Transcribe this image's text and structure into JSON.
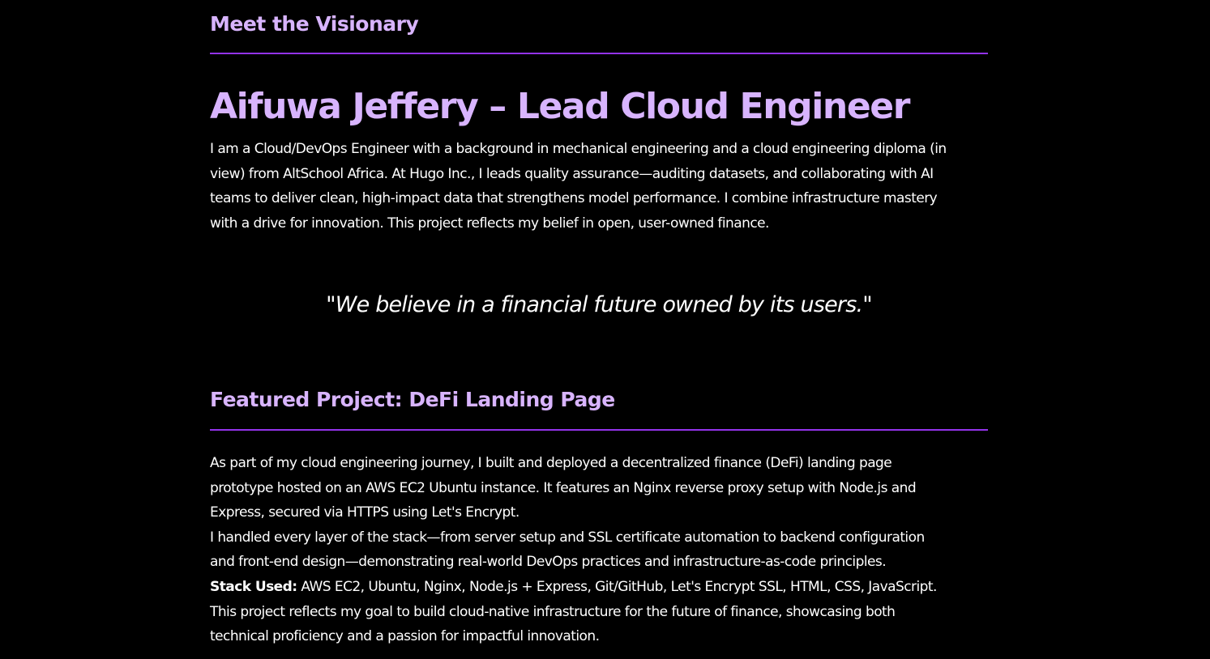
{
  "visionary_section": {
    "heading": "Meet the Visionary",
    "name_title": "Aifuwa Jeffery – Lead Cloud Engineer",
    "bio_lines": [
      "I am a Cloud/DevOps Engineer with a background in mechanical engineering and a cloud engineering diploma (in",
      "view) from AltSchool Africa. At Hugo Inc., I leads quality assurance—auditing datasets, and collaborating with AI",
      "teams to deliver clean, high-impact data that strengthens model performance. I combine infrastructure mastery",
      "with a drive for innovation. This project reflects my belief in open, user-owned finance."
    ],
    "quote": "\"We believe in a financial future owned by its users.\""
  },
  "project_section": {
    "heading": "Featured Project: DeFi Landing Page",
    "description_lines": [
      "As part of my cloud engineering journey, I built and deployed a decentralized finance (DeFi) landing page",
      "prototype hosted on an AWS EC2 Ubuntu instance. It features an Nginx reverse proxy setup with Node.js and",
      "Express, secured via HTTPS using Let's Encrypt.",
      "I handled every layer of the stack—from server setup and SSL certificate automation to backend configuration",
      "and front-end design—demonstrating real-world DevOps practices and infrastructure-as-code principles."
    ],
    "stack_label": "Stack Used:",
    "stack_value": " AWS EC2, Ubuntu, Nginx, Node.js + Express, Git/GitHub, Let's Encrypt SSL, HTML, CSS, JavaScript.",
    "closing_lines": [
      "This project reflects my goal to build cloud-native infrastructure for the future of finance, showcasing both",
      "technical proficiency and a passion for impactful innovation."
    ]
  },
  "colors": {
    "background": "#000000",
    "heading": "#d8b4fe",
    "divider": "#9333ea",
    "text": "#ffffff"
  }
}
